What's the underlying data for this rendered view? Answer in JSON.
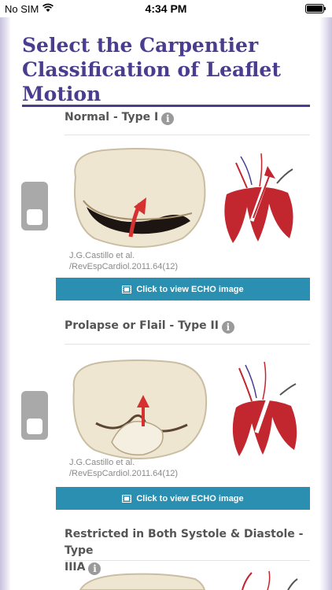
{
  "status_bar": {
    "carrier": "No SIM",
    "time": "4:34 PM"
  },
  "page": {
    "title": "Select the Carpentier Classification of Leaflet Motion"
  },
  "options": [
    {
      "heading": "Normal - Type I",
      "info_icon": "i",
      "credit_line1": "J.G.Castillo et al.",
      "credit_line2": "/RevEspCardiol.2011.64(12)",
      "button_label": "Click to view ECHO image",
      "illustration": "normal-valve"
    },
    {
      "heading": "Prolapse or Flail - Type II",
      "info_icon": "i",
      "credit_line1": "J.G.Castillo et al.",
      "credit_line2": "/RevEspCardiol.2011.64(12)",
      "button_label": "Click to view ECHO image",
      "illustration": "prolapse-valve"
    },
    {
      "heading_line1": "Restricted in Both Systole & Diastole - Type",
      "heading_line2": "IIIA",
      "info_icon": "i",
      "illustration": "restricted-valve"
    }
  ],
  "colors": {
    "title": "#4a3d8f",
    "button": "#2a8fb0",
    "heart_red": "#c2262e",
    "toggle": "#a9a9a9"
  }
}
